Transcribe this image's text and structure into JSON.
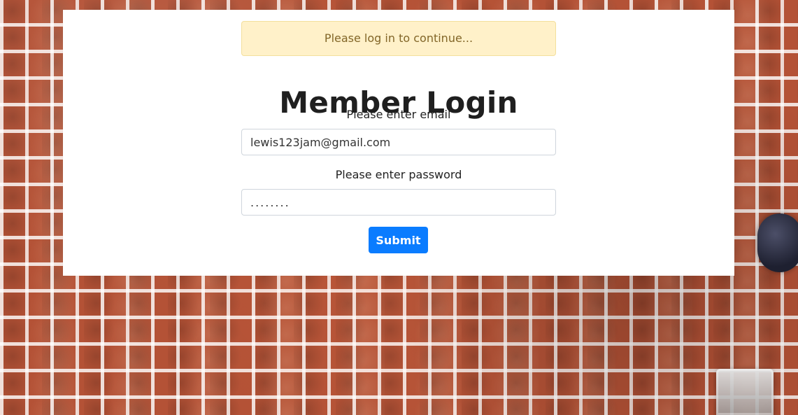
{
  "alert": {
    "message": "Please log in to continue..."
  },
  "login": {
    "title": "Member Login",
    "email_label": "Please enter email",
    "email_value": "lewis123jam@gmail.com",
    "password_label": "Please enter password",
    "password_mask": "........",
    "submit_label": "Submit"
  },
  "colors": {
    "alert_background": "#fff1c9",
    "alert_border": "#f3df9c",
    "alert_text": "#826628",
    "submit_button": "#0a7cff",
    "card_background": "#ffffff"
  }
}
